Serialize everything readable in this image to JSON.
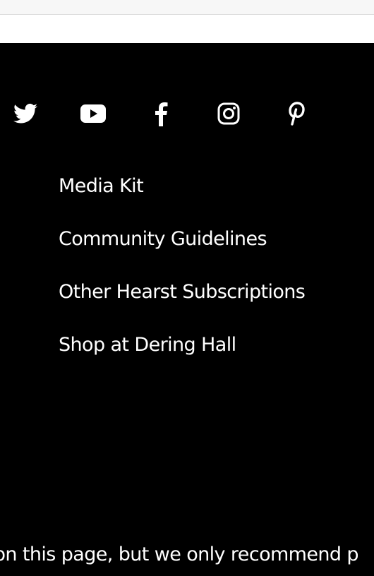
{
  "footer": {
    "social": [
      {
        "icon": "twitter-icon"
      },
      {
        "icon": "youtube-icon"
      },
      {
        "icon": "facebook-icon"
      },
      {
        "icon": "instagram-icon"
      },
      {
        "icon": "pinterest-icon"
      }
    ],
    "links": [
      {
        "label": "Media Kit"
      },
      {
        "label": "Community Guidelines"
      },
      {
        "label": "Other Hearst Subscriptions"
      },
      {
        "label": "Shop at Dering Hall"
      }
    ],
    "disclaimer": "s on this page, but we only recommend p"
  },
  "colors": {
    "background": "#000000",
    "text": "#ffffff",
    "top_strip": "#f7f7f7",
    "band": "#ffffff"
  }
}
